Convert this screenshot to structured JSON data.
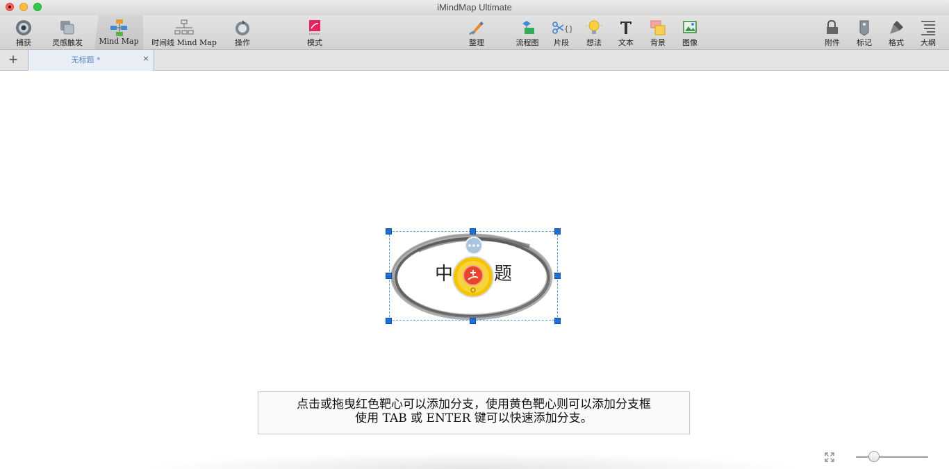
{
  "window": {
    "title": "iMindMap Ultimate"
  },
  "toolbar": {
    "left": [
      {
        "label": "捕获",
        "icon": "capture-icon"
      },
      {
        "label": "灵感触发",
        "icon": "brainstorm-icon"
      },
      {
        "label": "Mind Map",
        "icon": "mind-map-view-icon",
        "active": true
      },
      {
        "label": "时间线 Mind Map",
        "icon": "timeline-icon"
      },
      {
        "label": "操作",
        "icon": "action-icon"
      },
      {
        "label": "模式",
        "icon": "mode-icon"
      }
    ],
    "middle": [
      {
        "label": "整理",
        "icon": "organize-icon"
      },
      {
        "label": "流程图",
        "icon": "flowchart-icon"
      },
      {
        "label": "片段",
        "icon": "snippets-icon"
      },
      {
        "label": "想法",
        "icon": "idea-bulb-icon"
      },
      {
        "label": "文本",
        "icon": "text-icon"
      },
      {
        "label": "背景",
        "icon": "background-icon"
      },
      {
        "label": "图像",
        "icon": "image-icon"
      }
    ],
    "right": [
      {
        "label": "附件",
        "icon": "attachment-icon"
      },
      {
        "label": "标记",
        "icon": "marker-icon"
      },
      {
        "label": "格式",
        "icon": "format-icon"
      },
      {
        "label": "大纲",
        "icon": "outline-icon"
      }
    ]
  },
  "tabs": {
    "add_symbol": "+",
    "active_tab": {
      "title": "无标题 *",
      "close_symbol": "×"
    }
  },
  "canvas": {
    "central_topic": {
      "left_char": "中",
      "right_char": "题"
    },
    "hint_line1": "点击或拖曳红色靶心可以添加分支，使用黄色靶心则可以添加分支框",
    "hint_line2": "使用 TAB 或 ENTER 键可以快速添加分支。"
  },
  "zoom": {
    "level": 0.2
  },
  "colors": {
    "selection": "#1f6fd8",
    "tab_text": "#5a87c6",
    "target_yellow": "#f5c400",
    "target_red": "#e8452b"
  }
}
